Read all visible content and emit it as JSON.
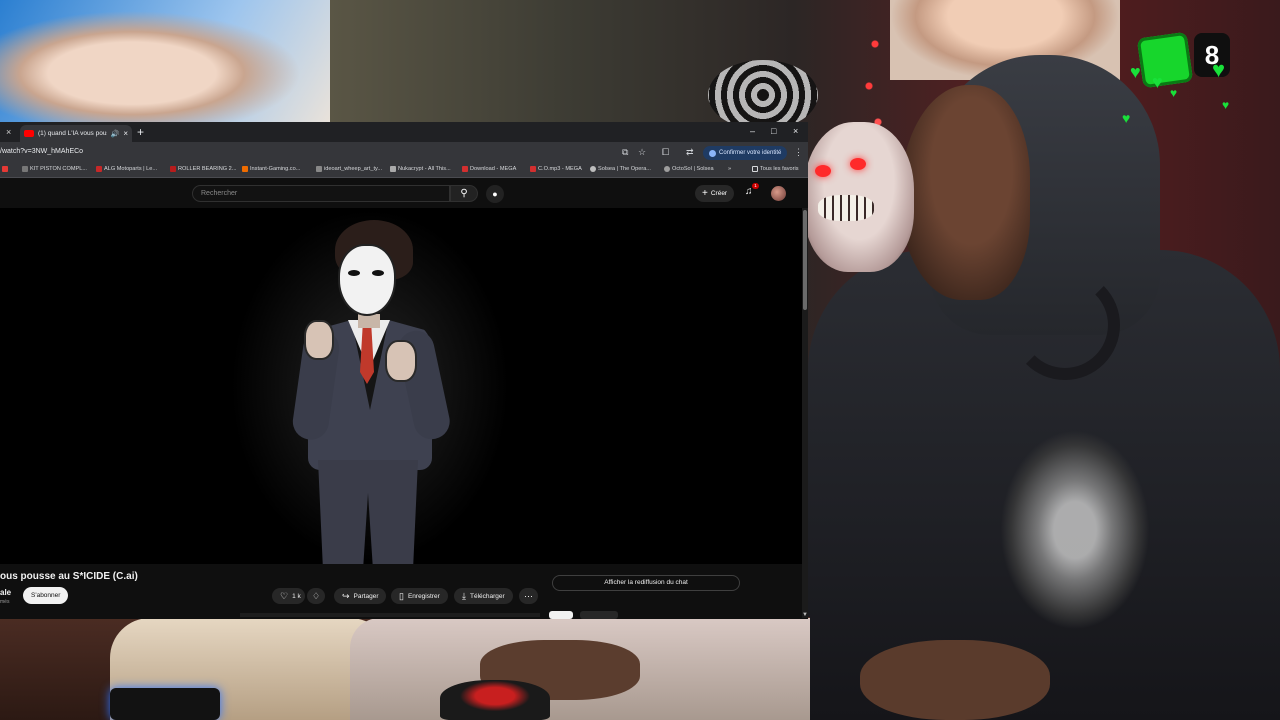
{
  "overlay": {
    "count": "8"
  },
  "browser": {
    "tab": {
      "title": "(1) quand L'IA vous pousse"
    },
    "url": "/watch?v=3NW_hMAhECo",
    "confirm_identity": "Confirmer votre identité",
    "bookmarks": [
      "KIT PISTON COMPL...",
      "ALG Motoparts | Le...",
      "ROLLER BEARING 2...",
      "Instant-Gaming.co...",
      "ideoart_wheep_art_ty...",
      "Nukacrypt - All This...",
      "Download - MEGA",
      "C.O.mp3 - MEGA",
      "Solsea | The Opera...",
      "OctoSol | Solsea"
    ],
    "all_favorites": "Tous les favoris"
  },
  "youtube": {
    "search_placeholder": "Rechercher",
    "create_label": "Créer",
    "notif_count": "1",
    "video_title": "ous pousse au S*ICIDE (C.ai)",
    "channel_name": "ale",
    "channel_subs": "més",
    "subscribe_label": "S'abonner",
    "likes": "1 k",
    "share_label": "Partager",
    "save_label": "Enregistrer",
    "download_label": "Télécharger",
    "chat_replay_label": "Afficher la rediffusion du chat"
  },
  "icons": {
    "close": "×",
    "plus": "+",
    "minimize": "–",
    "maximize": "□",
    "search": "⚲",
    "mic": "🎙",
    "bell": "🔔",
    "like": "👍",
    "dislike": "👎",
    "share": "↪",
    "save": "🔖",
    "download": "⤓",
    "more": "⋯",
    "star": "☆",
    "speaker": "🔊",
    "heart": "♥"
  },
  "colors": {
    "youtube_red": "#ff0000",
    "overlay_green": "#19e13a"
  }
}
